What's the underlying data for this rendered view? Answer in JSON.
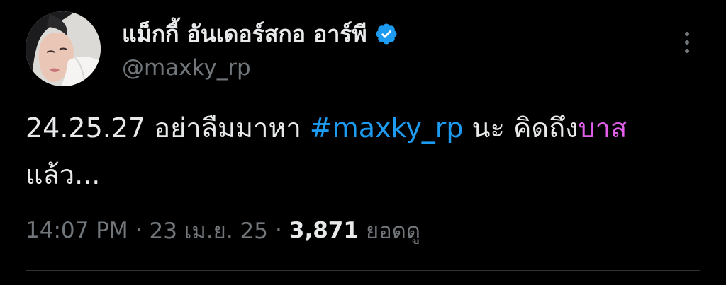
{
  "author": {
    "display_name": "แม็กกี้ อันเดอร์สกอ อาร์พี",
    "handle": "@maxky_rp",
    "verified": true
  },
  "tweet": {
    "text_prefix": "24.25.27 อย่าลืมมาหา ",
    "hashtag": "#maxky_rp",
    "text_middle": " นะ คิดถึง",
    "highlight": "บาส",
    "text_line2": "แล้ว..."
  },
  "meta": {
    "time": "14:07 PM",
    "separator": "·",
    "date": "23 เม.ย. 25",
    "views_count": "3,871",
    "views_label": "ยอดดู"
  },
  "colors": {
    "background": "#000000",
    "primary_text": "#e7e9ea",
    "secondary_text": "#71767b",
    "hashtag": "#1d9bf0",
    "highlight": "#e05fe8",
    "verified_badge": "#1d9bf0"
  },
  "icons": {
    "verified": "verified-badge-icon",
    "more": "more-options-icon"
  }
}
